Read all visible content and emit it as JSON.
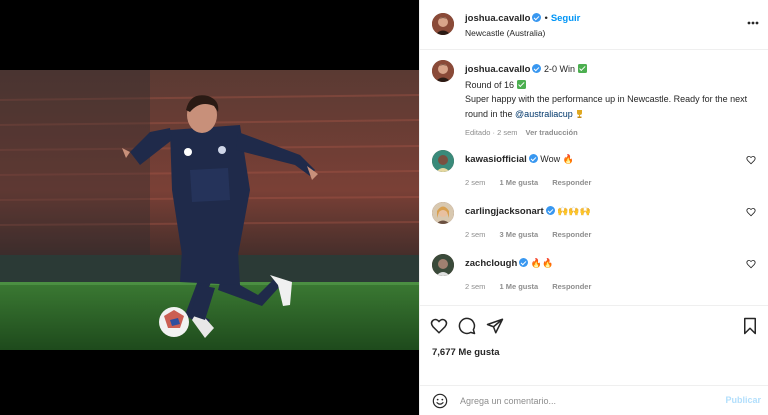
{
  "post": {
    "author": "joshua.cavallo",
    "follow_label": "Seguir",
    "location": "Newcastle (Australia)",
    "more_icon": "more-options-icon"
  },
  "caption": {
    "username": "joshua.cavallo",
    "line1": "2-0 Win",
    "line2": "Round of 16",
    "line3_start": "Super happy with the performance up in Newcastle. Ready for the next round in the ",
    "mention": "@australiacup",
    "edited": "Editado",
    "time": "2 sem",
    "see_translation": "Ver traducción"
  },
  "comments": [
    {
      "username": "kawasiofficial",
      "text": "Wow",
      "emoji": "🔥",
      "time": "2 sem",
      "likes": "1 Me gusta",
      "reply": "Responder"
    },
    {
      "username": "carlingjacksonart",
      "text": "",
      "emoji": "🙌🙌🙌",
      "time": "2 sem",
      "likes": "3 Me gusta",
      "reply": "Responder"
    },
    {
      "username": "zachclough",
      "text": "",
      "emoji": "🔥🔥",
      "time": "2 sem",
      "likes": "1 Me gusta",
      "reply": "Responder"
    }
  ],
  "actions": {
    "likes_count": "7,677 Me gusta"
  },
  "add_comment": {
    "placeholder": "Agrega un comentario...",
    "post_label": "Publicar"
  },
  "colors": {
    "accent": "#0095f6",
    "verified": "#3897f0",
    "jersey": "#1f2a4a",
    "pitch": "#2f6b2a"
  }
}
